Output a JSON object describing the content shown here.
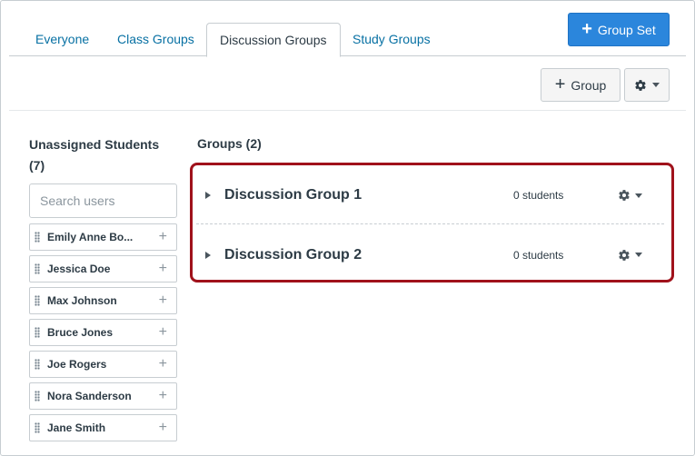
{
  "tabs": [
    "Everyone",
    "Class Groups",
    "Discussion Groups",
    "Study Groups"
  ],
  "active_tab": "Discussion Groups",
  "add_group_set_label": "Group Set",
  "add_group_label": "Group",
  "unassigned": {
    "title": "Unassigned Students (7)",
    "search_placeholder": "Search users",
    "students": [
      "Emily Anne Bo...",
      "Jessica Doe",
      "Max Johnson",
      "Bruce Jones",
      "Joe Rogers",
      "Nora Sanderson",
      "Jane Smith"
    ]
  },
  "groups": {
    "title": "Groups (2)",
    "items": [
      {
        "name": "Discussion Group 1",
        "count": "0 students"
      },
      {
        "name": "Discussion Group 2",
        "count": "0 students"
      }
    ]
  },
  "colors": {
    "primary": "#2b86dc",
    "link": "#0770a3",
    "highlight_border": "#a0121b"
  },
  "icons": [
    "plus-icon",
    "gear-icon",
    "dropdown-arrow-icon",
    "drag-handle-icon",
    "expand-caret-icon"
  ]
}
